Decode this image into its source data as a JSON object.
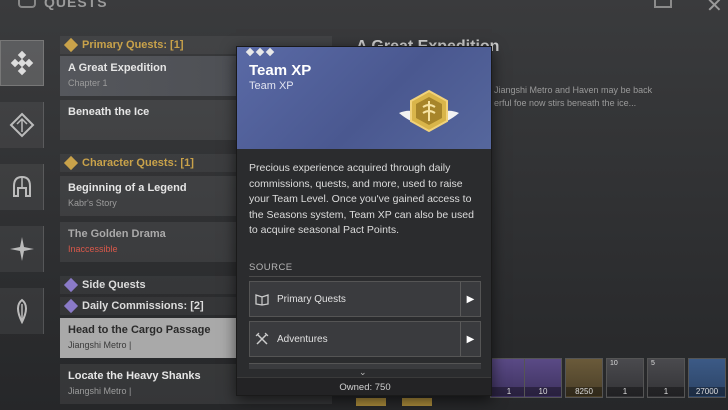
{
  "window": {
    "title": "QUESTS"
  },
  "rail": {
    "items": [
      {
        "icon": "quest-cluster-icon",
        "active": true
      },
      {
        "icon": "diamond-icon",
        "active": false
      },
      {
        "icon": "helmet-icon",
        "active": false
      },
      {
        "icon": "star-compass-icon",
        "active": false
      },
      {
        "icon": "feather-icon",
        "active": false
      }
    ]
  },
  "quests": {
    "primary_header": "Primary Quests: [1]",
    "primary": [
      {
        "title": "A Great Expedition",
        "subtitle": "Chapter 1"
      },
      {
        "title": "Beneath the Ice",
        "subtitle": ""
      }
    ],
    "character_header": "Character Quests: [1]",
    "character": [
      {
        "title": "Beginning of a Legend",
        "subtitle": "Kabr's Story"
      },
      {
        "title": "The Golden Drama",
        "subtitle": "Inaccessible"
      }
    ],
    "side_header": "Side Quests",
    "daily_header": "Daily Commissions: [2]",
    "daily": [
      {
        "title": "Head to the Cargo Passage",
        "subtitle": "Jiangshi Metro  |"
      },
      {
        "title": "Locate the Heavy Shanks",
        "subtitle": "Jiangshi Metro  |"
      }
    ]
  },
  "details": {
    "title": "A Great Expedition",
    "description": "Jiangshi Metro and Haven may be back\nerful foe now stirs beneath the ice..."
  },
  "tooltip": {
    "title": "Team XP",
    "type": "Team XP",
    "description": "Precious experience acquired through daily commissions, quests, and more, used to raise your Team Level. Once you've gained access to the Seasons system, Team XP can also be used to acquire seasonal Pact Points.",
    "source_label": "SOURCE",
    "sources": [
      {
        "label": "Primary Quests",
        "icon": "quest-book-icon"
      },
      {
        "label": "Adventures",
        "icon": "crossed-swords-icon"
      }
    ],
    "owned": "Owned: 750"
  },
  "rewards": [
    {
      "qty": "1",
      "badge": "",
      "rarity": "purple",
      "icon": "unknown-item-icon"
    },
    {
      "qty": "10",
      "badge": "",
      "rarity": "purple",
      "icon": "crystal-icon"
    },
    {
      "qty": "8250",
      "badge": "",
      "rarity": "gold",
      "icon": "team-xp-icon"
    },
    {
      "qty": "1",
      "badge": "10",
      "rarity": "dark",
      "icon": "weapon-icon"
    },
    {
      "qty": "1",
      "badge": "5",
      "rarity": "dark",
      "icon": "weapon-icon"
    },
    {
      "qty": "27000",
      "badge": "",
      "rarity": "blue",
      "icon": "currency-icon"
    }
  ],
  "colors": {
    "accent_gold": "#c9a24a",
    "header_blue": "#4a5890",
    "inaccessible_red": "#d9584a"
  }
}
